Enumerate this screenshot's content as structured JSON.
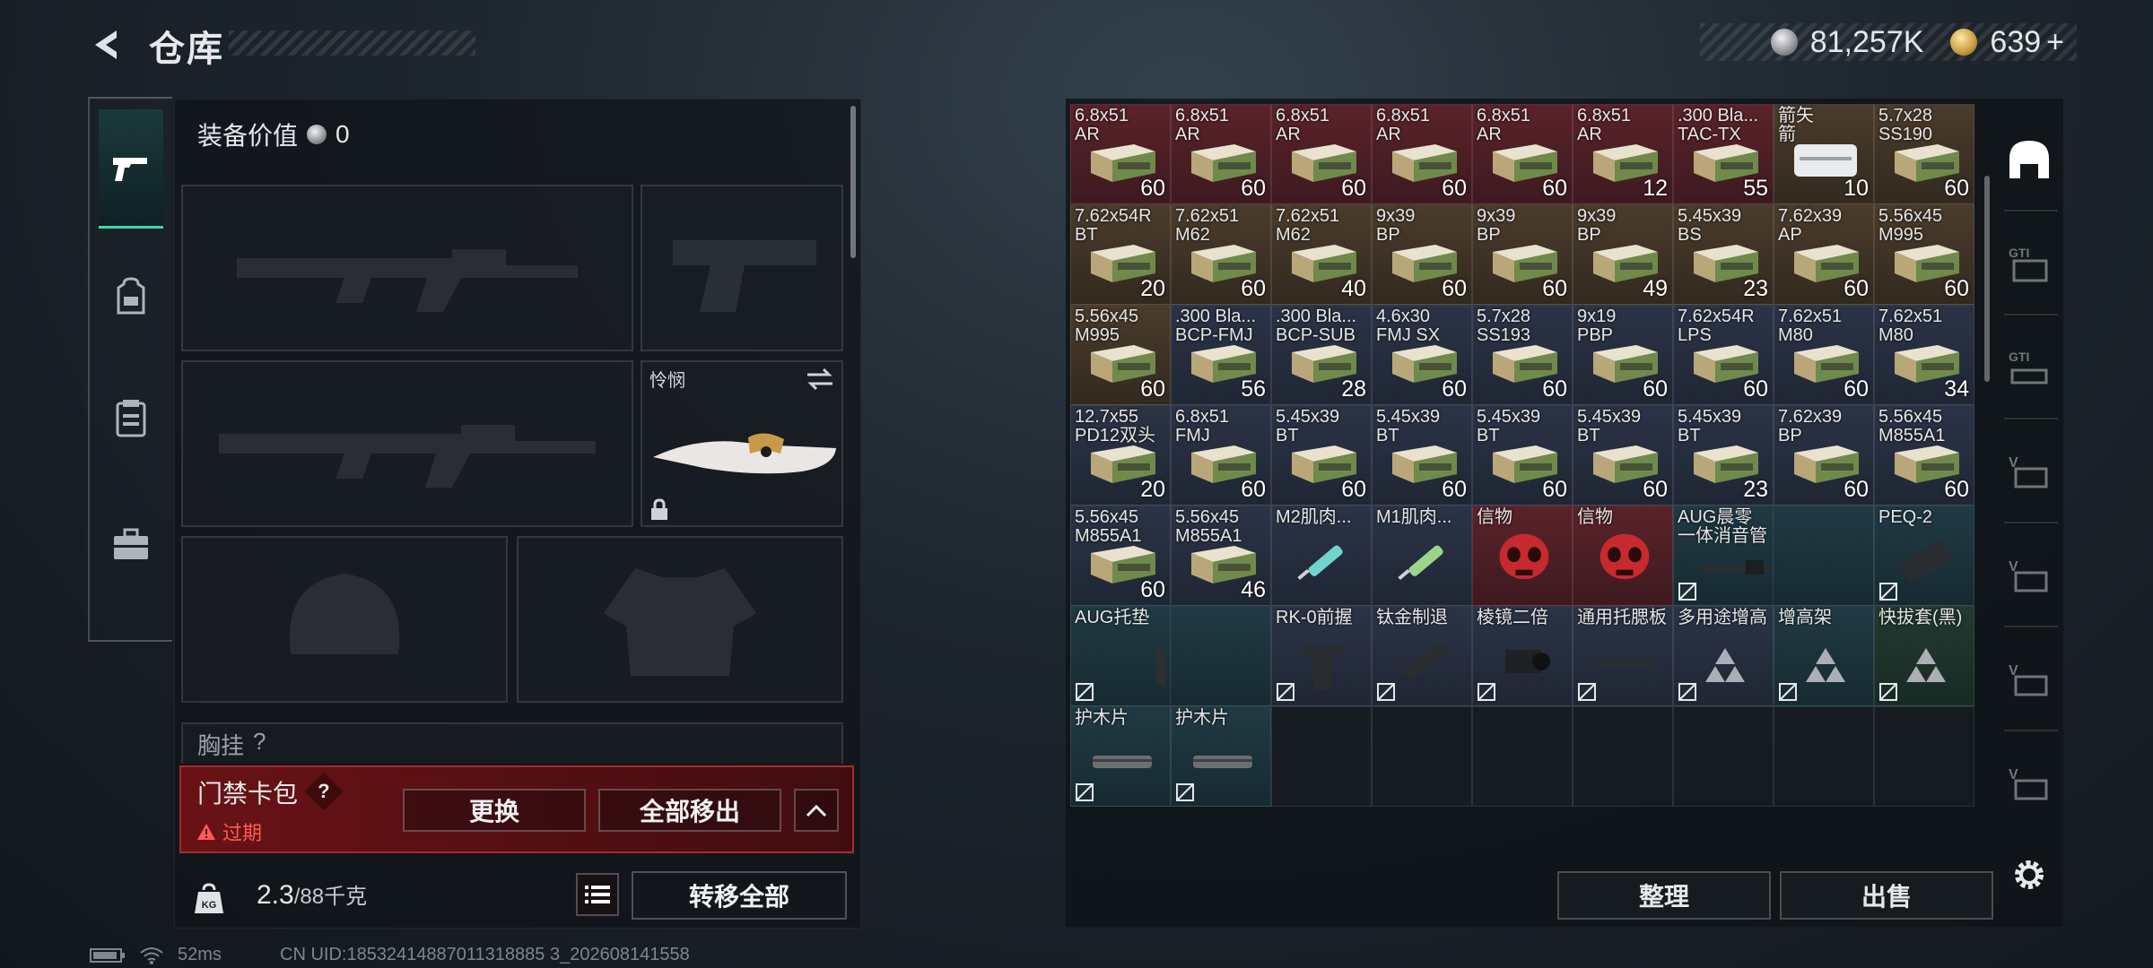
{
  "header": {
    "title": "仓库",
    "silver": "81,257K",
    "gold": "639",
    "plus": "+"
  },
  "left_tabs": [
    "gun-icon",
    "backpack-icon",
    "vest-icon",
    "case-icon"
  ],
  "loadout": {
    "equip_value_label": "装备价值",
    "equip_value": "0",
    "knife_name": "怜悯",
    "next_section_label": "胸挂",
    "next_section_hint": "?"
  },
  "access_card": {
    "title": "门禁卡包",
    "help": "?",
    "status": "过期",
    "replace_label": "更换",
    "remove_all_label": "全部移出"
  },
  "capacity": {
    "current": "2.3",
    "max_unit": "/88千克",
    "weight_icon_text": "KG",
    "transfer_all_label": "转移全部"
  },
  "items": [
    {
      "name": "6.8x51\nAR",
      "count": "60",
      "bg": "red",
      "icon": "ammo-box"
    },
    {
      "name": "6.8x51\nAR",
      "count": "60",
      "bg": "red",
      "icon": "ammo-box"
    },
    {
      "name": "6.8x51\nAR",
      "count": "60",
      "bg": "red",
      "icon": "ammo-box"
    },
    {
      "name": "6.8x51\nAR",
      "count": "60",
      "bg": "red",
      "icon": "ammo-box"
    },
    {
      "name": "6.8x51\nAR",
      "count": "60",
      "bg": "red",
      "icon": "ammo-box"
    },
    {
      "name": "6.8x51\nAR",
      "count": "12",
      "bg": "red",
      "icon": "ammo-box"
    },
    {
      "name": ".300 Bla...\nTAC-TX",
      "count": "55",
      "bg": "red",
      "icon": "ammo-box"
    },
    {
      "name": "箭矢\n箭",
      "count": "10",
      "bg": "brown",
      "icon": "arrow-case"
    },
    {
      "name": "5.7x28\nSS190",
      "count": "60",
      "bg": "brown",
      "icon": "ammo-box"
    },
    {
      "name": "7.62x54R\nBT",
      "count": "20",
      "bg": "brown",
      "icon": "ammo-box"
    },
    {
      "name": "7.62x51\nM62",
      "count": "60",
      "bg": "brown",
      "icon": "ammo-box"
    },
    {
      "name": "7.62x51\nM62",
      "count": "40",
      "bg": "brown",
      "icon": "ammo-box"
    },
    {
      "name": "9x39\nBP",
      "count": "60",
      "bg": "brown",
      "icon": "ammo-box"
    },
    {
      "name": "9x39\nBP",
      "count": "60",
      "bg": "brown",
      "icon": "ammo-box"
    },
    {
      "name": "9x39\nBP",
      "count": "49",
      "bg": "brown",
      "icon": "ammo-box"
    },
    {
      "name": "5.45x39\nBS",
      "count": "23",
      "bg": "brown",
      "icon": "ammo-box"
    },
    {
      "name": "7.62x39\nAP",
      "count": "60",
      "bg": "brown",
      "icon": "ammo-box"
    },
    {
      "name": "5.56x45\nM995",
      "count": "60",
      "bg": "brown",
      "icon": "ammo-box"
    },
    {
      "name": "5.56x45\nM995",
      "count": "60",
      "bg": "brown",
      "icon": "ammo-box"
    },
    {
      "name": ".300 Bla...\nBCP-FMJ",
      "count": "56",
      "bg": "blue",
      "icon": "ammo-box"
    },
    {
      "name": ".300 Bla...\nBCP-SUB",
      "count": "28",
      "bg": "blue",
      "icon": "ammo-box"
    },
    {
      "name": "4.6x30\nFMJ SX",
      "count": "60",
      "bg": "blue",
      "icon": "ammo-box"
    },
    {
      "name": "5.7x28\nSS193",
      "count": "60",
      "bg": "blue",
      "icon": "ammo-box"
    },
    {
      "name": "9x19\nPBP",
      "count": "60",
      "bg": "blue",
      "icon": "ammo-box"
    },
    {
      "name": "7.62x54R\nLPS",
      "count": "60",
      "bg": "blue",
      "icon": "ammo-box"
    },
    {
      "name": "7.62x51\nM80",
      "count": "60",
      "bg": "blue",
      "icon": "ammo-box"
    },
    {
      "name": "7.62x51\nM80",
      "count": "34",
      "bg": "blue",
      "icon": "ammo-box"
    },
    {
      "name": "12.7x55\nPD12双头",
      "count": "20",
      "bg": "blue",
      "icon": "ammo-box"
    },
    {
      "name": "6.8x51\nFMJ",
      "count": "60",
      "bg": "blue",
      "icon": "ammo-box"
    },
    {
      "name": "5.45x39\nBT",
      "count": "60",
      "bg": "blue",
      "icon": "ammo-box"
    },
    {
      "name": "5.45x39\nBT",
      "count": "60",
      "bg": "blue",
      "icon": "ammo-box"
    },
    {
      "name": "5.45x39\nBT",
      "count": "60",
      "bg": "blue",
      "icon": "ammo-box"
    },
    {
      "name": "5.45x39\nBT",
      "count": "60",
      "bg": "blue",
      "icon": "ammo-box"
    },
    {
      "name": "5.45x39\nBT",
      "count": "23",
      "bg": "blue",
      "icon": "ammo-box"
    },
    {
      "name": "7.62x39\nBP",
      "count": "60",
      "bg": "blue",
      "icon": "ammo-box"
    },
    {
      "name": "5.56x45\nM855A1",
      "count": "60",
      "bg": "blue",
      "icon": "ammo-box"
    },
    {
      "name": "5.56x45\nM855A1",
      "count": "60",
      "bg": "blue",
      "icon": "ammo-box"
    },
    {
      "name": "5.56x45\nM855A1",
      "count": "46",
      "bg": "blue",
      "icon": "ammo-box"
    },
    {
      "name": "M2肌肉...",
      "count": "",
      "bg": "blue",
      "icon": "syringe-teal"
    },
    {
      "name": "M1肌肉...",
      "count": "",
      "bg": "blue",
      "icon": "syringe-green"
    },
    {
      "name": "信物",
      "count": "",
      "bg": "red",
      "icon": "red-mask"
    },
    {
      "name": "信物",
      "count": "",
      "bg": "red",
      "icon": "red-mask"
    },
    {
      "name": "AUG晨零\n一体消音管",
      "count": "",
      "bg": "teal",
      "icon": "suppressor",
      "lock": true
    },
    {
      "name": "",
      "count": "",
      "bg": "teal",
      "icon": "",
      "span": true
    },
    {
      "name": "PEQ-2",
      "count": "",
      "bg": "teal",
      "icon": "laser-box",
      "lock": true
    },
    {
      "name": "AUG托垫",
      "count": "",
      "bg": "teal",
      "icon": "stock-pad",
      "lock": true
    },
    {
      "name": "",
      "count": "",
      "bg": "teal",
      "icon": "",
      "span": true
    },
    {
      "name": "RK-0前握",
      "count": "",
      "bg": "blue",
      "icon": "foregrip",
      "lock": true
    },
    {
      "name": "钛金制退",
      "count": "",
      "bg": "blue",
      "icon": "muzzle-brake",
      "lock": true
    },
    {
      "name": "棱镜二倍",
      "count": "",
      "bg": "blue",
      "icon": "prism-scope",
      "lock": true
    },
    {
      "name": "通用托腮板",
      "count": "",
      "bg": "blue",
      "icon": "cheek-rest",
      "lock": true
    },
    {
      "name": "多用途增高",
      "count": "",
      "bg": "blue",
      "icon": "triangle-mark",
      "lock": true
    },
    {
      "name": "增高架",
      "count": "",
      "bg": "teal",
      "icon": "triangle-mark",
      "lock": true
    },
    {
      "name": "快拔套(黑)",
      "count": "",
      "bg": "green",
      "icon": "triangle-mark",
      "lock": true
    },
    {
      "name": "护木片",
      "count": "",
      "bg": "teal",
      "icon": "rail-cover",
      "lock": true
    },
    {
      "name": "护木片",
      "count": "",
      "bg": "teal",
      "icon": "rail-cover",
      "lock": true
    }
  ],
  "grid_actions": {
    "sort_label": "整理",
    "sell_label": "出售"
  },
  "right_tabs": [
    "helmet-icon",
    "gti-tab-1-icon",
    "gti-tab-2-icon",
    "v-tab-1-icon",
    "v-tab-2-icon",
    "v-tab-3-icon",
    "v-tab-4-icon"
  ],
  "status": {
    "ping": "52ms",
    "uid": "CN UID:18532414887011318885 3_202608141558"
  },
  "colors": {
    "accent_green": "#46d3ad",
    "alert_red": "#ff5b54"
  }
}
